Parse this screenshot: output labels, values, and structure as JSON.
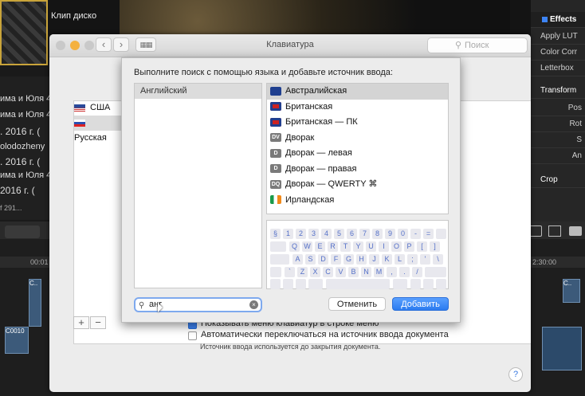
{
  "background_app": {
    "clip_title": "Клип диско",
    "left_list": [
      "има и Юля 4",
      "има и Юля 4",
      ". 2016 г. (",
      "olodozheny",
      ". 2016 г. (",
      "има и Юля 4",
      "2016 г. (",
      "f 291..."
    ],
    "right_panel": {
      "effects_label": "Effects",
      "items": [
        "Apply LUT",
        "Color Corr",
        "Letterbox",
        "Transform",
        "Pos",
        "Rot",
        "S",
        "An",
        "Crop"
      ]
    },
    "timeline_labels": [
      "00:01",
      "2:30:00",
      "C0010",
      "C..",
      "C.."
    ]
  },
  "window": {
    "title": "Клавиатура",
    "search_placeholder": "Поиск",
    "sources": [
      {
        "label": "США",
        "flag": "us"
      },
      {
        "label": "Русская",
        "flag": "ru"
      }
    ],
    "add_button": "+",
    "remove_button": "−",
    "show_menu_label": "Показывать меню клавиатур в строке меню",
    "auto_switch_label": "Автоматически переключаться на источник ввода документа",
    "note": "Источник ввода используется до закрытия документа.",
    "help": "?"
  },
  "dialog": {
    "instruction": "Выполните поиск с помощью языка и добавьте источник ввода:",
    "languages": [
      "Английский"
    ],
    "input_sources": [
      {
        "label": "Австралийская",
        "icon": "au-flag-icon",
        "icon_text": "",
        "selected": true
      },
      {
        "label": "Британская",
        "icon": "uk-flag-icon",
        "icon_text": "",
        "selected": false
      },
      {
        "label": "Британская — ПК",
        "icon": "uk-flag-icon",
        "icon_text": "",
        "selected": false
      },
      {
        "label": "Дворак",
        "icon": "dvorak-icon",
        "icon_text": "DV",
        "selected": false
      },
      {
        "label": "Дворак — левая",
        "icon": "dvorak-left-icon",
        "icon_text": "D",
        "selected": false
      },
      {
        "label": "Дворак — правая",
        "icon": "dvorak-right-icon",
        "icon_text": "D",
        "selected": false
      },
      {
        "label": "Дворак — QWERTY ⌘",
        "icon": "dvorak-qwerty-icon",
        "icon_text": "DQ",
        "selected": false
      },
      {
        "label": "Ирландская",
        "icon": "ie-flag-icon",
        "icon_text": "",
        "selected": false
      }
    ],
    "keyboard_rows": [
      [
        "§",
        "1",
        "2",
        "3",
        "4",
        "5",
        "6",
        "7",
        "8",
        "9",
        "0",
        "-",
        "="
      ],
      [
        "Q",
        "W",
        "E",
        "R",
        "T",
        "Y",
        "U",
        "I",
        "O",
        "P",
        "[",
        "]"
      ],
      [
        "A",
        "S",
        "D",
        "F",
        "G",
        "H",
        "J",
        "K",
        "L",
        ";",
        "'",
        "\\"
      ],
      [
        "`",
        "Z",
        "X",
        "C",
        "V",
        "B",
        "N",
        "M",
        ",",
        ".",
        "/"
      ]
    ],
    "search_value": "анг",
    "cancel_button": "Отменить",
    "add_button": "Добавить"
  }
}
